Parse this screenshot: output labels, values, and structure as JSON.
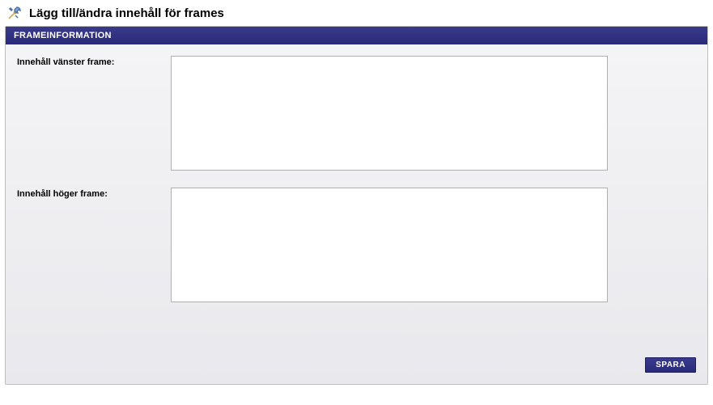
{
  "header": {
    "icon_name": "tools-icon",
    "title": "Lägg till/ändra innehåll för frames"
  },
  "panel": {
    "title": "FRAMEINFORMATION",
    "fields": {
      "left_frame": {
        "label": "Innehåll vänster frame:",
        "value": ""
      },
      "right_frame": {
        "label": "Innehåll höger frame:",
        "value": ""
      }
    },
    "buttons": {
      "save_label": "SPARA"
    }
  },
  "colors": {
    "accent": "#2e2e80",
    "panel_border": "#bfbfbf",
    "body_bg_top": "#f4f4f6",
    "body_bg_bottom": "#e9e9ed"
  }
}
